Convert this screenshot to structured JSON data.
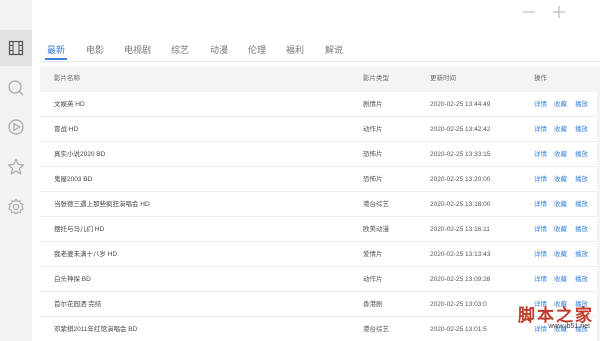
{
  "window": {
    "minimize_icon": "minimize-icon",
    "maximize_icon": "plus-icon"
  },
  "sidebar": {
    "items": [
      {
        "name": "video-library",
        "icon": "film-grid-icon",
        "active": true
      },
      {
        "name": "search",
        "icon": "search-icon",
        "active": false
      },
      {
        "name": "play",
        "icon": "play-circle-icon",
        "active": false
      },
      {
        "name": "favorites",
        "icon": "star-icon",
        "active": false
      },
      {
        "name": "settings",
        "icon": "gear-icon",
        "active": false
      }
    ]
  },
  "tabs": [
    {
      "label": "最新",
      "active": true
    },
    {
      "label": "电影",
      "active": false
    },
    {
      "label": "电视剧",
      "active": false
    },
    {
      "label": "综艺",
      "active": false
    },
    {
      "label": "动漫",
      "active": false
    },
    {
      "label": "伦理",
      "active": false
    },
    {
      "label": "福利",
      "active": false
    },
    {
      "label": "解说",
      "active": false
    }
  ],
  "table": {
    "headers": {
      "name": "影片名称",
      "category": "影片类型",
      "time": "更新时间",
      "actions": "操作"
    },
    "action_labels": {
      "detail": "详情",
      "collect": "收藏",
      "play": "播放"
    },
    "rows": [
      {
        "name": "文娱英 HD",
        "category": "剧情片",
        "time": "2020-02-25 13:44:49"
      },
      {
        "name": "冒战 HD",
        "category": "动作片",
        "time": "2020-02-25 13:42:42"
      },
      {
        "name": "真实小说2020 BD",
        "category": "恐怖片",
        "time": "2020-02-25 13:33:15"
      },
      {
        "name": "鬼屋2003 BD",
        "category": "恐怖片",
        "time": "2020-02-25 13:20:00"
      },
      {
        "name": "当张德三遇上那些疯狂演唱会 HD",
        "category": "港台综艺",
        "time": "2020-02-25 13:18:00"
      },
      {
        "name": "摆托与马儿们 HD",
        "category": "欧美动漫",
        "time": "2020-02-25 13:16:11"
      },
      {
        "name": "我老婆未满十八岁 HD",
        "category": "爱情片",
        "time": "2020-02-25 13:13:43"
      },
      {
        "name": "白头神探 BD",
        "category": "动作片",
        "time": "2020-02-25 13:09:28"
      },
      {
        "name": "首尔花园洒 完结",
        "category": "香港剧",
        "time": "2020-02-25 13:03:0"
      },
      {
        "name": "邓紫棋2011年红馆演唱会 BD",
        "category": "港台综艺",
        "time": "2020-02-25 13:01:5"
      }
    ]
  },
  "watermark": {
    "brand": "脚本之家",
    "url": "www.jb51.net"
  },
  "colors": {
    "accent": "#3e7ed6",
    "link": "#3e86e0",
    "sidebar_bg": "#f2f2f2",
    "header_bg": "#f4f4f4",
    "watermark": "#c0392b"
  }
}
